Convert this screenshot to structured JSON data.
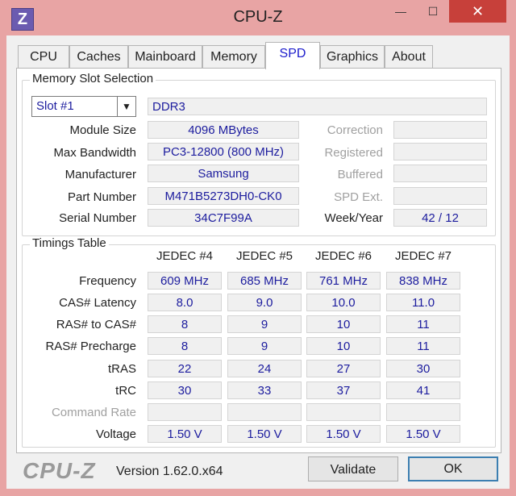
{
  "window": {
    "title": "CPU-Z",
    "app_icon": "Z",
    "minimize": "—",
    "maximize": "☐",
    "close": "✕"
  },
  "tabs": [
    "CPU",
    "Caches",
    "Mainboard",
    "Memory",
    "SPD",
    "Graphics",
    "About"
  ],
  "active_tab": "SPD",
  "slot_section": {
    "title": "Memory Slot Selection",
    "slot_value": "Slot #1",
    "memory_type": "DDR3",
    "module_size": {
      "label": "Module Size",
      "value": "4096 MBytes"
    },
    "max_bandwidth": {
      "label": "Max Bandwidth",
      "value": "PC3-12800 (800 MHz)"
    },
    "manufacturer": {
      "label": "Manufacturer",
      "value": "Samsung"
    },
    "part_number": {
      "label": "Part Number",
      "value": "M471B5273DH0-CK0"
    },
    "serial_number": {
      "label": "Serial Number",
      "value": "34C7F99A"
    },
    "correction": {
      "label": "Correction",
      "value": ""
    },
    "registered": {
      "label": "Registered",
      "value": ""
    },
    "buffered": {
      "label": "Buffered",
      "value": ""
    },
    "spd_ext": {
      "label": "SPD Ext.",
      "value": ""
    },
    "week_year": {
      "label": "Week/Year",
      "value": "42 / 12"
    }
  },
  "timings": {
    "title": "Timings Table",
    "columns": [
      "JEDEC #4",
      "JEDEC #5",
      "JEDEC #6",
      "JEDEC #7"
    ],
    "rows": [
      {
        "label": "Frequency",
        "values": [
          "609 MHz",
          "685 MHz",
          "761 MHz",
          "838 MHz"
        ]
      },
      {
        "label": "CAS# Latency",
        "values": [
          "8.0",
          "9.0",
          "10.0",
          "11.0"
        ]
      },
      {
        "label": "RAS# to CAS#",
        "values": [
          "8",
          "9",
          "10",
          "11"
        ]
      },
      {
        "label": "RAS# Precharge",
        "values": [
          "8",
          "9",
          "10",
          "11"
        ]
      },
      {
        "label": "tRAS",
        "values": [
          "22",
          "24",
          "27",
          "30"
        ]
      },
      {
        "label": "tRC",
        "values": [
          "30",
          "33",
          "37",
          "41"
        ]
      },
      {
        "label": "Command Rate",
        "values": [
          "",
          "",
          "",
          ""
        ]
      },
      {
        "label": "Voltage",
        "values": [
          "1.50 V",
          "1.50 V",
          "1.50 V",
          "1.50 V"
        ]
      }
    ]
  },
  "footer": {
    "logo": "CPU-Z",
    "version": "Version 1.62.0.x64",
    "validate": "Validate",
    "ok": "OK"
  }
}
